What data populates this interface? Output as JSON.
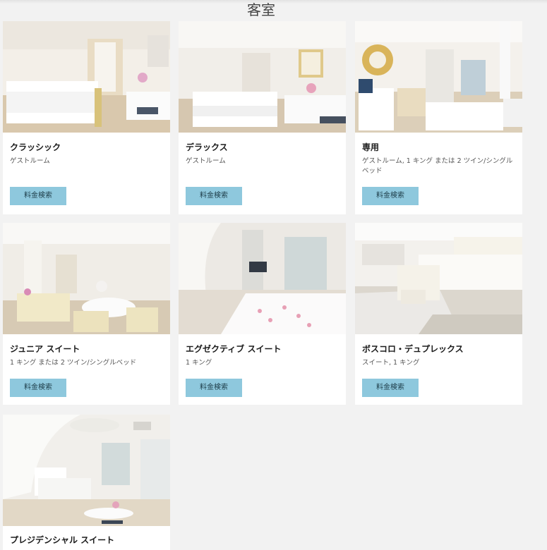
{
  "page": {
    "title": "客室"
  },
  "rooms": [
    {
      "name": "クラッシック",
      "desc": "ゲストルーム",
      "button": "料金検索"
    },
    {
      "name": "デラックス",
      "desc": "ゲストルーム",
      "button": "料金検索"
    },
    {
      "name": "専用",
      "desc": "ゲストルーム, 1 キング または 2 ツイン/シングルベッド",
      "button": "料金検索"
    },
    {
      "name": "ジュニア スイート",
      "desc": "1 キング または 2 ツイン/シングルベッド",
      "button": "料金検索"
    },
    {
      "name": "エグゼクティブ スイート",
      "desc": "1 キング",
      "button": "料金検索"
    },
    {
      "name": "ボスコロ・デュプレックス",
      "desc": "スイート, 1 キング",
      "button": "料金検索"
    },
    {
      "name": "プレジデンシャル スイート",
      "desc": "",
      "button": ""
    }
  ]
}
